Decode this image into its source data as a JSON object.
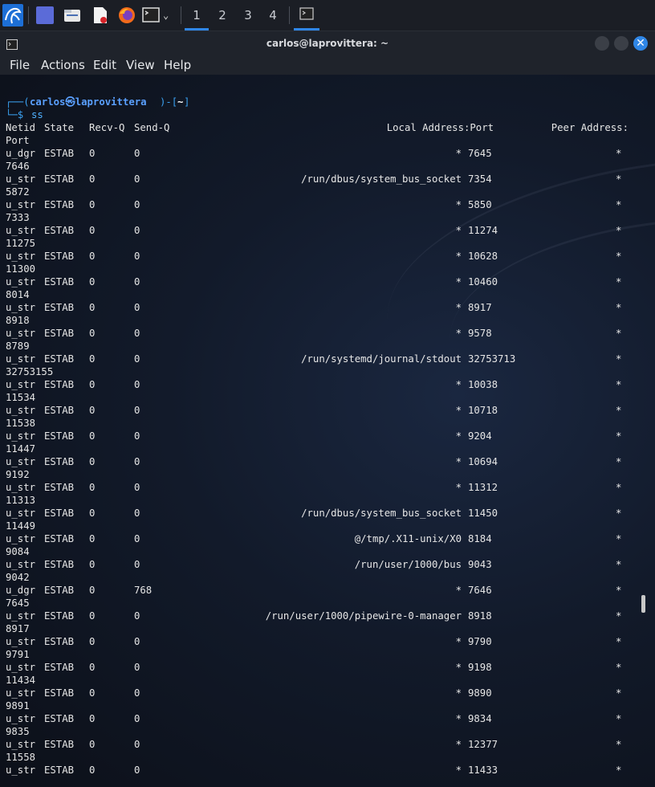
{
  "panel": {
    "workspaces": [
      "1",
      "2",
      "3",
      "4"
    ]
  },
  "window": {
    "title": "carlos@laprovittera: ~",
    "close_label": "✕"
  },
  "menu": [
    "File",
    "Actions",
    "Edit",
    "View",
    "Help"
  ],
  "prompt": {
    "line1_open": "┌──(",
    "user": "carlos㉿laprovittera",
    "line1_close": ")-[",
    "cwd": "~",
    "line1_end": "]",
    "line2_prefix": "└─$ ",
    "command": "ss"
  },
  "header": {
    "netid": "Netid",
    "state": "State",
    "recvq": "Recv-Q",
    "sendq": "Send-Q",
    "local": "Local Address:Port",
    "peer": "Peer Address:",
    "port_wrap": "Port"
  },
  "rows": [
    {
      "netid": "u_dgr",
      "state": "ESTAB",
      "recvq": "0",
      "sendq": "0",
      "local_addr": "*",
      "local_port": "7645",
      "peer_addr": "*",
      "peer_port": "7646"
    },
    {
      "netid": "u_str",
      "state": "ESTAB",
      "recvq": "0",
      "sendq": "0",
      "local_addr": "/run/dbus/system_bus_socket",
      "local_port": "7354",
      "peer_addr": "*",
      "peer_port": "5872"
    },
    {
      "netid": "u_str",
      "state": "ESTAB",
      "recvq": "0",
      "sendq": "0",
      "local_addr": "*",
      "local_port": "5850",
      "peer_addr": "*",
      "peer_port": "7333"
    },
    {
      "netid": "u_str",
      "state": "ESTAB",
      "recvq": "0",
      "sendq": "0",
      "local_addr": "*",
      "local_port": "11274",
      "peer_addr": "*",
      "peer_port": "11275"
    },
    {
      "netid": "u_str",
      "state": "ESTAB",
      "recvq": "0",
      "sendq": "0",
      "local_addr": "*",
      "local_port": "10628",
      "peer_addr": "*",
      "peer_port": "11300"
    },
    {
      "netid": "u_str",
      "state": "ESTAB",
      "recvq": "0",
      "sendq": "0",
      "local_addr": "*",
      "local_port": "10460",
      "peer_addr": "*",
      "peer_port": "8014"
    },
    {
      "netid": "u_str",
      "state": "ESTAB",
      "recvq": "0",
      "sendq": "0",
      "local_addr": "*",
      "local_port": "8917",
      "peer_addr": "*",
      "peer_port": "8918"
    },
    {
      "netid": "u_str",
      "state": "ESTAB",
      "recvq": "0",
      "sendq": "0",
      "local_addr": "*",
      "local_port": "9578",
      "peer_addr": "*",
      "peer_port": "8789"
    },
    {
      "netid": "u_str",
      "state": "ESTAB",
      "recvq": "0",
      "sendq": "0",
      "local_addr": "/run/systemd/journal/stdout",
      "local_port": "32753713",
      "peer_addr": "*",
      "peer_port": "32753155"
    },
    {
      "netid": "u_str",
      "state": "ESTAB",
      "recvq": "0",
      "sendq": "0",
      "local_addr": "*",
      "local_port": "10038",
      "peer_addr": "*",
      "peer_port": "11534"
    },
    {
      "netid": "u_str",
      "state": "ESTAB",
      "recvq": "0",
      "sendq": "0",
      "local_addr": "*",
      "local_port": "10718",
      "peer_addr": "*",
      "peer_port": "11538"
    },
    {
      "netid": "u_str",
      "state": "ESTAB",
      "recvq": "0",
      "sendq": "0",
      "local_addr": "*",
      "local_port": "9204",
      "peer_addr": "*",
      "peer_port": "11447"
    },
    {
      "netid": "u_str",
      "state": "ESTAB",
      "recvq": "0",
      "sendq": "0",
      "local_addr": "*",
      "local_port": "10694",
      "peer_addr": "*",
      "peer_port": "9192"
    },
    {
      "netid": "u_str",
      "state": "ESTAB",
      "recvq": "0",
      "sendq": "0",
      "local_addr": "*",
      "local_port": "11312",
      "peer_addr": "*",
      "peer_port": "11313"
    },
    {
      "netid": "u_str",
      "state": "ESTAB",
      "recvq": "0",
      "sendq": "0",
      "local_addr": "/run/dbus/system_bus_socket",
      "local_port": "11450",
      "peer_addr": "*",
      "peer_port": "11449"
    },
    {
      "netid": "u_str",
      "state": "ESTAB",
      "recvq": "0",
      "sendq": "0",
      "local_addr": "@/tmp/.X11-unix/X0",
      "local_port": "8184",
      "peer_addr": "*",
      "peer_port": "9084"
    },
    {
      "netid": "u_str",
      "state": "ESTAB",
      "recvq": "0",
      "sendq": "0",
      "local_addr": "/run/user/1000/bus",
      "local_port": "9043",
      "peer_addr": "*",
      "peer_port": "9042"
    },
    {
      "netid": "u_dgr",
      "state": "ESTAB",
      "recvq": "0",
      "sendq": "768",
      "local_addr": "*",
      "local_port": "7646",
      "peer_addr": "*",
      "peer_port": "7645"
    },
    {
      "netid": "u_str",
      "state": "ESTAB",
      "recvq": "0",
      "sendq": "0",
      "local_addr": "/run/user/1000/pipewire-0-manager",
      "local_port": "8918",
      "peer_addr": "*",
      "peer_port": "8917"
    },
    {
      "netid": "u_str",
      "state": "ESTAB",
      "recvq": "0",
      "sendq": "0",
      "local_addr": "*",
      "local_port": "9790",
      "peer_addr": "*",
      "peer_port": "9791"
    },
    {
      "netid": "u_str",
      "state": "ESTAB",
      "recvq": "0",
      "sendq": "0",
      "local_addr": "*",
      "local_port": "9198",
      "peer_addr": "*",
      "peer_port": "11434"
    },
    {
      "netid": "u_str",
      "state": "ESTAB",
      "recvq": "0",
      "sendq": "0",
      "local_addr": "*",
      "local_port": "9890",
      "peer_addr": "*",
      "peer_port": "9891"
    },
    {
      "netid": "u_str",
      "state": "ESTAB",
      "recvq": "0",
      "sendq": "0",
      "local_addr": "*",
      "local_port": "9834",
      "peer_addr": "*",
      "peer_port": "9835"
    },
    {
      "netid": "u_str",
      "state": "ESTAB",
      "recvq": "0",
      "sendq": "0",
      "local_addr": "*",
      "local_port": "12377",
      "peer_addr": "*",
      "peer_port": "11558"
    },
    {
      "netid": "u_str",
      "state": "ESTAB",
      "recvq": "0",
      "sendq": "0",
      "local_addr": "*",
      "local_port": "11433",
      "peer_addr": "*",
      "peer_port": ""
    }
  ]
}
